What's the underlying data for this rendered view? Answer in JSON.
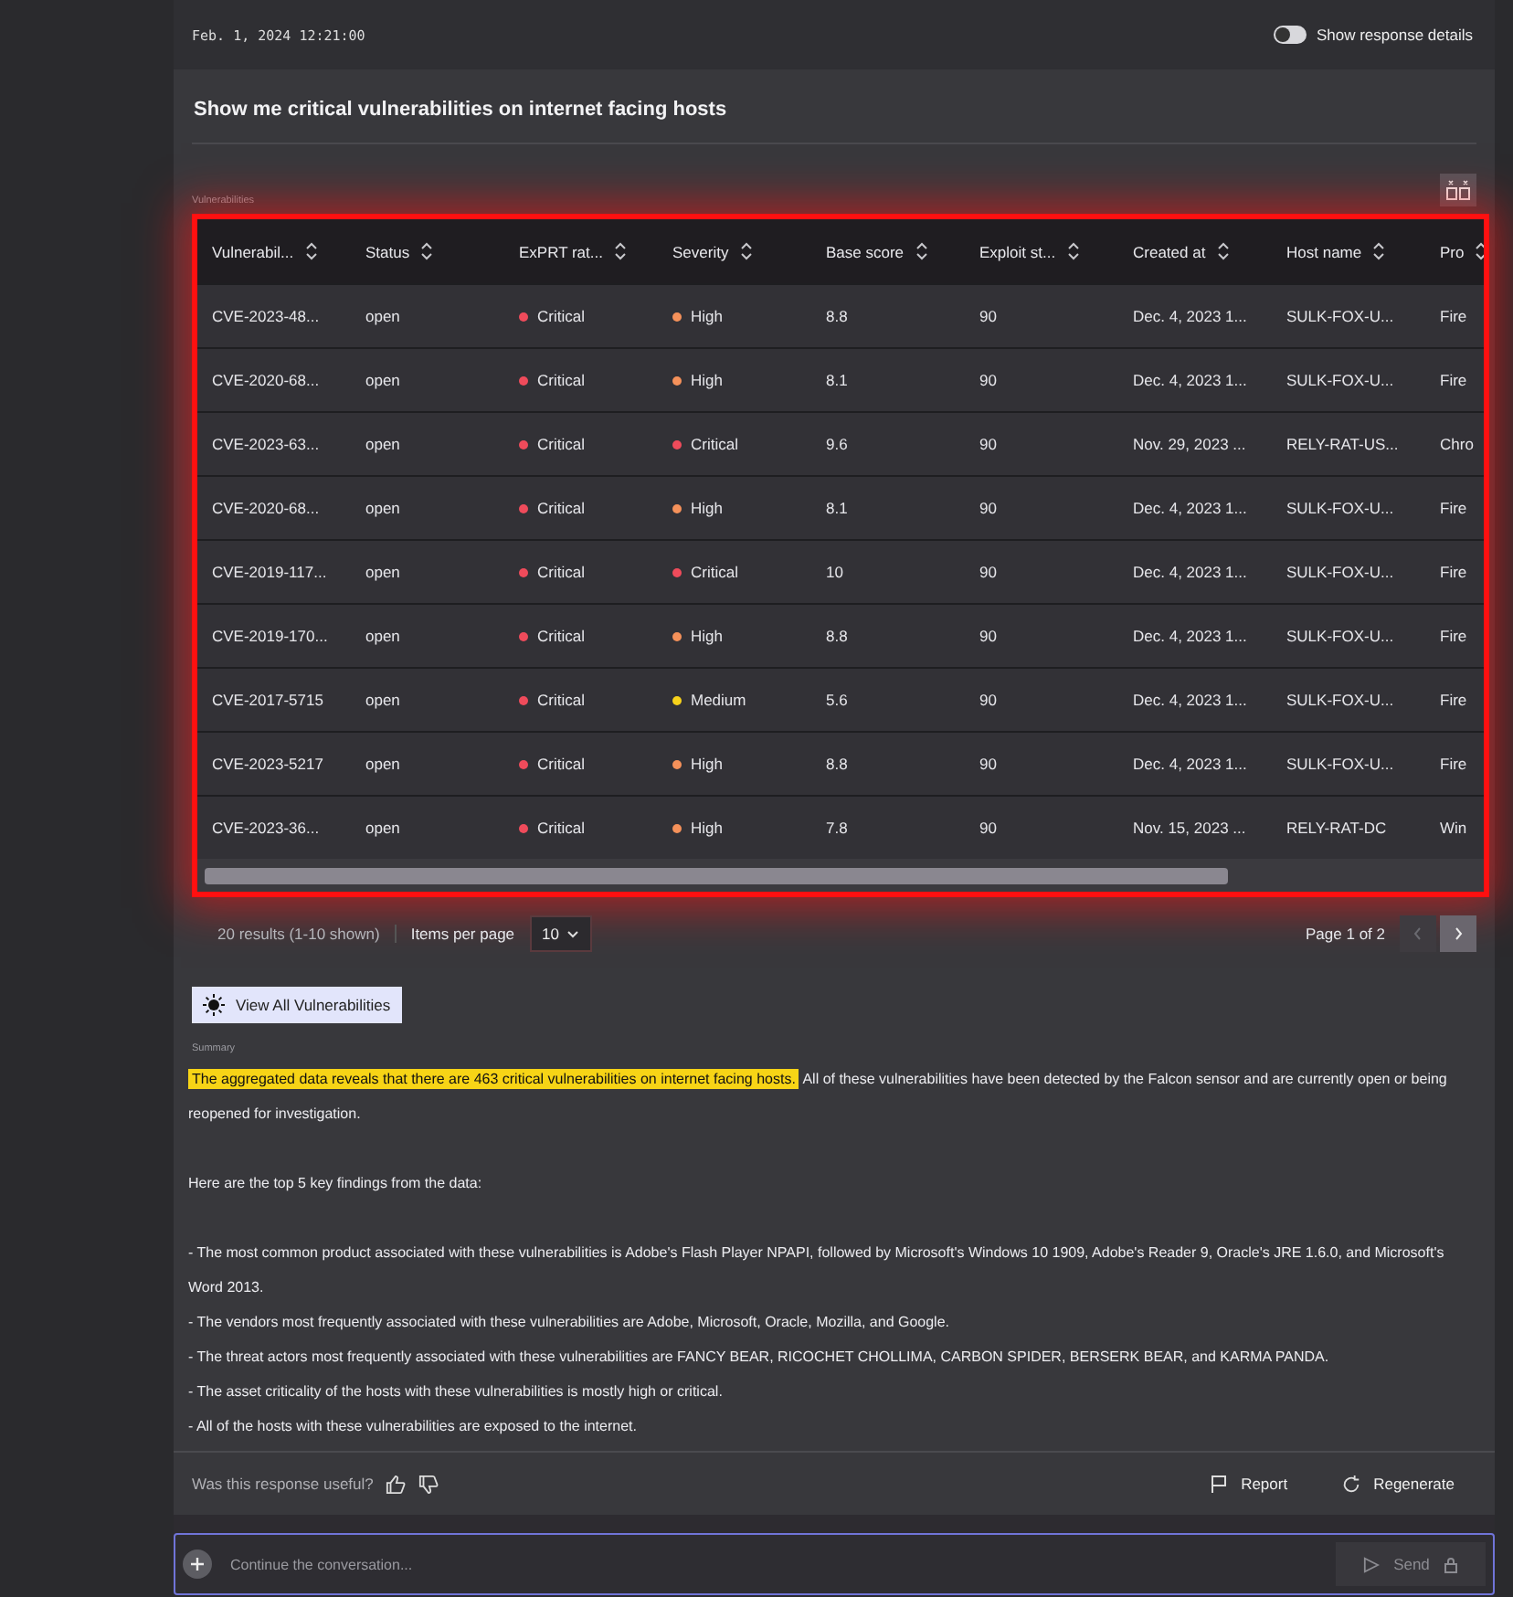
{
  "header": {
    "timestamp": "Feb. 1, 2024 12:21:00",
    "details_toggle": {
      "label": "Show response details",
      "on": false
    }
  },
  "prompt": "Show me critical vulnerabilities on internet facing hosts",
  "table": {
    "label": "Vulnerabilities",
    "columns": [
      "Vulnerabil...",
      "Status",
      "ExPRT rat...",
      "Severity",
      "Base score",
      "Exploit st...",
      "Created at",
      "Host name",
      "Pro"
    ],
    "rows": [
      {
        "cells": [
          "CVE-2023-48...",
          "open",
          {
            "text": "Critical",
            "color": "#ef4b5b"
          },
          {
            "text": "High",
            "color": "#f5915a"
          },
          "8.8",
          "90",
          "Dec. 4, 2023 1...",
          "SULK-FOX-U...",
          "Fire"
        ]
      },
      {
        "cells": [
          "CVE-2020-68...",
          "open",
          {
            "text": "Critical",
            "color": "#ef4b5b"
          },
          {
            "text": "High",
            "color": "#f5915a"
          },
          "8.1",
          "90",
          "Dec. 4, 2023 1...",
          "SULK-FOX-U...",
          "Fire"
        ]
      },
      {
        "cells": [
          "CVE-2023-63...",
          "open",
          {
            "text": "Critical",
            "color": "#ef4b5b"
          },
          {
            "text": "Critical",
            "color": "#ef4b5b"
          },
          "9.6",
          "90",
          "Nov. 29, 2023 ...",
          "RELY-RAT-US...",
          "Chro"
        ]
      },
      {
        "cells": [
          "CVE-2020-68...",
          "open",
          {
            "text": "Critical",
            "color": "#ef4b5b"
          },
          {
            "text": "High",
            "color": "#f5915a"
          },
          "8.1",
          "90",
          "Dec. 4, 2023 1...",
          "SULK-FOX-U...",
          "Fire"
        ]
      },
      {
        "cells": [
          "CVE-2019-117...",
          "open",
          {
            "text": "Critical",
            "color": "#ef4b5b"
          },
          {
            "text": "Critical",
            "color": "#ef4b5b"
          },
          "10",
          "90",
          "Dec. 4, 2023 1...",
          "SULK-FOX-U...",
          "Fire"
        ]
      },
      {
        "cells": [
          "CVE-2019-170...",
          "open",
          {
            "text": "Critical",
            "color": "#ef4b5b"
          },
          {
            "text": "High",
            "color": "#f5915a"
          },
          "8.8",
          "90",
          "Dec. 4, 2023 1...",
          "SULK-FOX-U...",
          "Fire"
        ]
      },
      {
        "cells": [
          "CVE-2017-5715",
          "open",
          {
            "text": "Critical",
            "color": "#ef4b5b"
          },
          {
            "text": "Medium",
            "color": "#f7d21b"
          },
          "5.6",
          "90",
          "Dec. 4, 2023 1...",
          "SULK-FOX-U...",
          "Fire"
        ]
      },
      {
        "cells": [
          "CVE-2023-5217",
          "open",
          {
            "text": "Critical",
            "color": "#ef4b5b"
          },
          {
            "text": "High",
            "color": "#f5915a"
          },
          "8.8",
          "90",
          "Dec. 4, 2023 1...",
          "SULK-FOX-U...",
          "Fire"
        ]
      },
      {
        "cells": [
          "CVE-2023-36...",
          "open",
          {
            "text": "Critical",
            "color": "#ef4b5b"
          },
          {
            "text": "High",
            "color": "#f5915a"
          },
          "7.8",
          "90",
          "Nov. 15, 2023 ...",
          "RELY-RAT-DC",
          "Win"
        ]
      }
    ],
    "results": "20 results (1-10 shown)",
    "per_page_label": "Items per page",
    "per_page": "10",
    "page": "Page 1 of 2",
    "prev": {
      "disabled": true
    },
    "next": {
      "disabled": false
    }
  },
  "view_all_button": "View All Vulnerabilities",
  "summary": {
    "label": "Summary",
    "highlighted": "The aggregated data reveals that there are 463 critical vulnerabilities on internet facing hosts.",
    "rest": " All of these vulnerabilities have been detected by the Falcon sensor and are currently open or being reopened for investigation.",
    "intro": "Here are the top 5 key findings from the data:",
    "findings": [
      "- The most common product associated with these vulnerabilities is Adobe's Flash Player NPAPI, followed by Microsoft's Windows 10 1909, Adobe's Reader 9, Oracle's JRE 1.6.0, and Microsoft's Word 2013.",
      "- The vendors most frequently associated with these vulnerabilities are Adobe, Microsoft, Oracle, Mozilla, and Google.",
      "- The threat actors most frequently associated with these vulnerabilities are FANCY BEAR, RICOCHET CHOLLIMA, CARBON SPIDER, BERSERK BEAR, and KARMA PANDA.",
      "- The asset criticality of the hosts with these vulnerabilities is mostly high or critical.",
      "- All of the hosts with these vulnerabilities are exposed to the internet."
    ]
  },
  "feedback": {
    "question": "Was this response useful?",
    "report": "Report",
    "regenerate": "Regenerate"
  },
  "composer": {
    "placeholder": "Continue the conversation...",
    "send": "Send"
  }
}
